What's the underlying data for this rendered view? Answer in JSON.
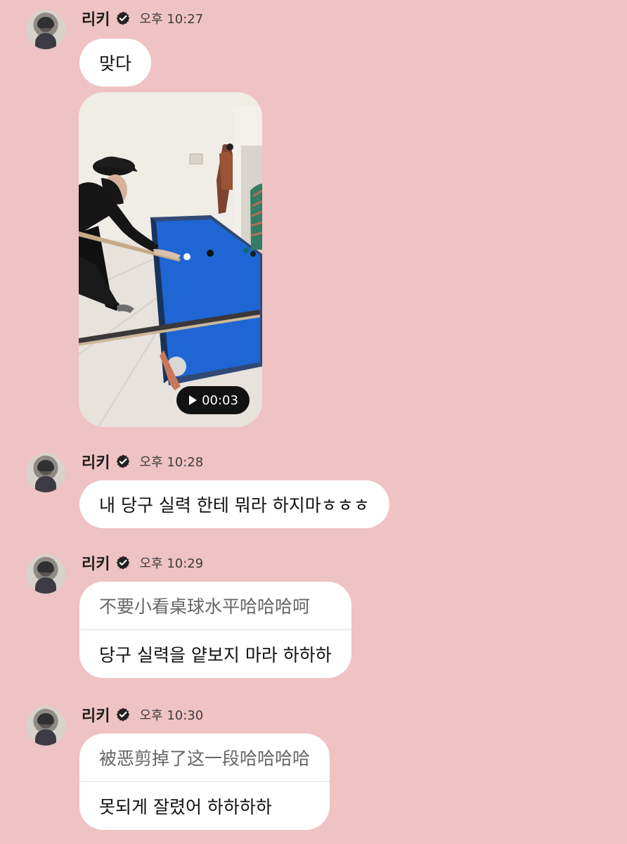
{
  "colors": {
    "background": "#efc2c4",
    "bubble": "#ffffff",
    "video_table": "#1f66d4",
    "duration_pill": "#000000"
  },
  "messages": [
    {
      "author": "리키",
      "time": "오후 10:27",
      "text": "맞다",
      "media": {
        "type": "video",
        "duration": "00:03"
      }
    },
    {
      "author": "리키",
      "time": "오후 10:28",
      "text": "내 당구 실력 한테 뭐라 하지마ㅎㅎㅎ"
    },
    {
      "author": "리키",
      "time": "오후 10:29",
      "translation": "不要小看桌球水平哈哈哈呵",
      "text": "당구 실력을 얕보지 마라 하하하"
    },
    {
      "author": "리키",
      "time": "오후 10:30",
      "translation": "被恶剪掉了这一段哈哈哈哈",
      "text": "못되게 잘렸어 하하하하"
    }
  ]
}
